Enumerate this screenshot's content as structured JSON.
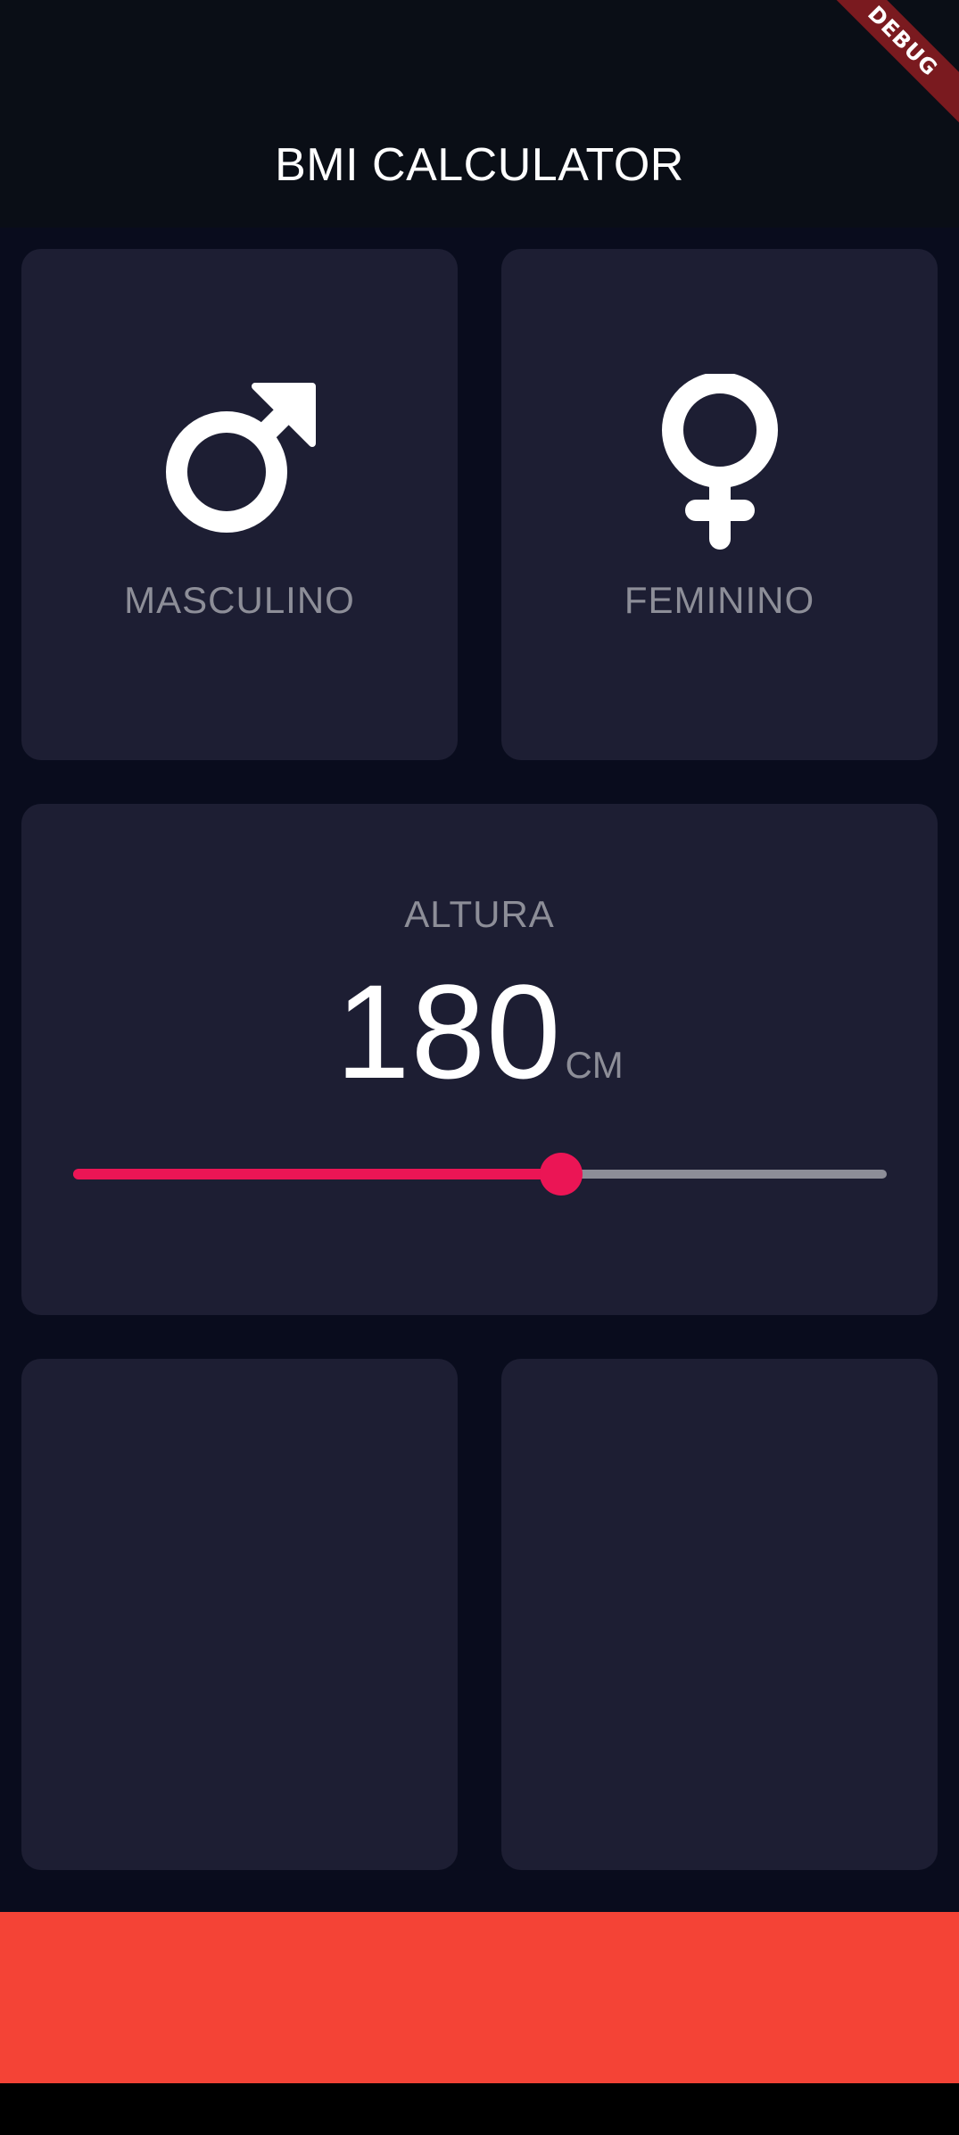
{
  "app_bar": {
    "title": "BMI CALCULATOR"
  },
  "debug_banner": {
    "label": "DEBUG"
  },
  "gender": {
    "male": {
      "label": "MASCULINO",
      "icon": "male-symbol-icon"
    },
    "female": {
      "label": "FEMININO",
      "icon": "female-symbol-icon"
    }
  },
  "height": {
    "label": "ALTURA",
    "value": "180",
    "unit": "CM",
    "slider_fraction": 0.6
  },
  "colors": {
    "background": "#090c1d",
    "app_bar": "#0a0e16",
    "card": "#1d1e33",
    "accent": "#eb1555",
    "label": "#8d8e98",
    "bottom_button": "#f44336",
    "debug_banner": "#7a1a1f"
  }
}
